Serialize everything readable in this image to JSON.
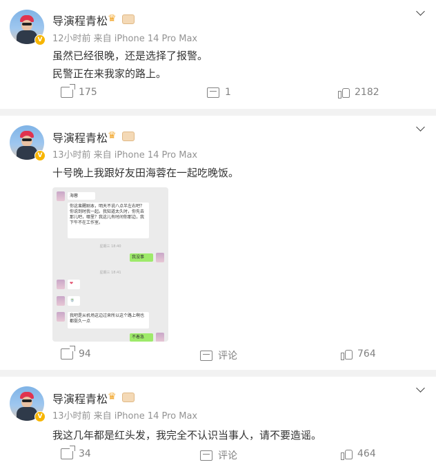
{
  "posts": [
    {
      "author": "导演程青松",
      "meta": "12小时前 来自 iPhone 14 Pro Max",
      "lines": [
        "虽然已经很晚，还是选择了报警。",
        "民警正在来我家的路上。"
      ],
      "repost": "175",
      "comment": "1",
      "like": "2182"
    },
    {
      "author": "导演程青松",
      "meta": "13小时前 来自 iPhone 14 Pro Max",
      "lines": [
        "十号晚上我跟好友田海蓉在一起吃晚饭。"
      ],
      "repost": "94",
      "comment": "评论",
      "like": "764",
      "chat": {
        "contact": "海蓉",
        "msg1": "你这蛮醒剧本，明天不说八点半左右吧？你说到时我一起。我知道太久时，你先去那儿吧，哪里？我这儿有时间你那边，我下午不在工作室。",
        "reply1": "我没事",
        "time1": "星期三 18:40",
        "time2": "星期三 18:41",
        "msg2": "❤",
        "msg3": "🍵",
        "msg4": "我吧是从机场这边过来所以这个路上啊也都挺久一点",
        "reply2": "不着急"
      }
    },
    {
      "author": "导演程青松",
      "meta": "13小时前 来自 iPhone 14 Pro Max",
      "lines": [
        "我这几年都是红头发，我完全不认识当事人，请不要造谣。"
      ],
      "repost": "34",
      "comment": "评论",
      "like": "464"
    }
  ],
  "badge_letter": "V"
}
